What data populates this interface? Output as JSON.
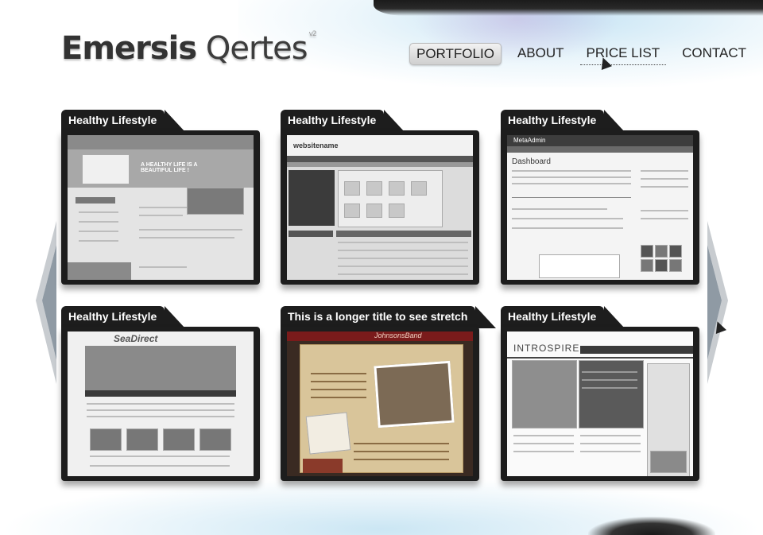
{
  "site": {
    "title_bold": "Emersis",
    "title_light": "Qertes",
    "title_sup": "v2"
  },
  "nav": [
    {
      "label": "PORTFOLIO",
      "active": true
    },
    {
      "label": "ABOUT"
    },
    {
      "label": "PRICE LIST",
      "dotted": true
    },
    {
      "label": "CONTACT"
    }
  ],
  "cards": [
    {
      "title": "Healthy Lifestyle",
      "site_text": "A HEALTHY LIFE IS A BEAUTIFUL LIFE !"
    },
    {
      "title": "Healthy Lifestyle",
      "site_text": "websitename"
    },
    {
      "title": "Healthy Lifestyle",
      "site_text": "MetaAdmin"
    },
    {
      "title": "Healthy Lifestyle",
      "site_text": "SeaDirect"
    },
    {
      "title": "This is a longer title to see stretch",
      "site_text": "JohnsonsBand"
    },
    {
      "title": "Healthy Lifestyle",
      "site_text": "INTROSPIRE"
    }
  ],
  "icons": {
    "left_arrow": "left-arrow-icon",
    "right_arrow": "right-arrow-icon",
    "cursor": "hand-cursor-icon"
  },
  "colors": {
    "card": "#1d1d1d",
    "accent": "#8ec9e6"
  }
}
